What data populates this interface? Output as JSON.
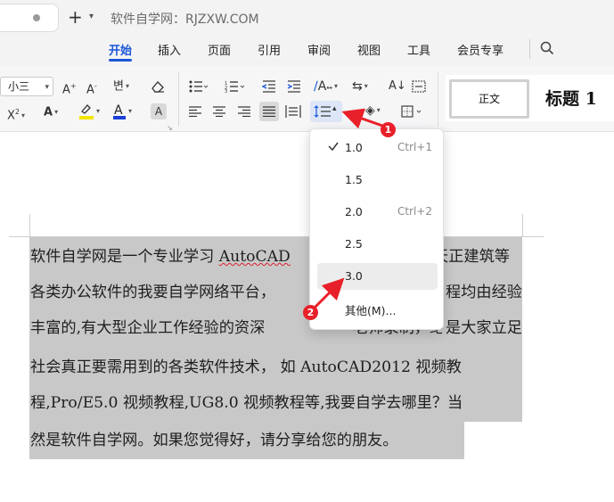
{
  "window": {
    "title": "软件自学网：RJZXW.COM"
  },
  "menu": {
    "items": [
      {
        "label": "开始",
        "active": true
      },
      {
        "label": "插入"
      },
      {
        "label": "页面"
      },
      {
        "label": "引用"
      },
      {
        "label": "审阅"
      },
      {
        "label": "视图"
      },
      {
        "label": "工具"
      },
      {
        "label": "会员专享"
      }
    ]
  },
  "ribbon": {
    "font_size": "小三",
    "styles": {
      "body_label": "正文",
      "heading_label": "标题 1"
    },
    "colors": {
      "highlight": "#f2e600",
      "font_color": "#1a3fd6",
      "accent": "#1a56d6"
    }
  },
  "line_spacing_menu": {
    "options": [
      {
        "label": "1.0",
        "shortcut": "Ctrl+1",
        "checked": true
      },
      {
        "label": "1.5",
        "shortcut": ""
      },
      {
        "label": "2.0",
        "shortcut": "Ctrl+2"
      },
      {
        "label": "2.5",
        "shortcut": ""
      },
      {
        "label": "3.0",
        "shortcut": "",
        "hover": true
      },
      {
        "label": "其他(M)...",
        "shortcut": ""
      }
    ]
  },
  "document": {
    "lines": [
      [
        "软件自学网是一个专业学习 ",
        "AutoCAD",
        "",
        "天正建筑等"
      ],
      [
        "各类办公软件的我要自学网络平台，",
        "",
        "",
        "程均由经验"
      ],
      [
        "丰富的,有大型企业工作经验的资深",
        "",
        "",
        "是大家立足"
      ],
      [
        "社会真正要需用到的各类软件技术， 如 AutoCAD2012 视频教"
      ],
      [
        "程,Pro/E5.0 视频教程,UG8.0 视频教程等,我要自学去哪里？当"
      ],
      [
        "然是软件自学网。如果您觉得好，请分享给您的朋友。"
      ]
    ],
    "behind_menu": [
      "老师录制，绝对"
    ]
  },
  "annotations": {
    "badge1": "1",
    "badge2": "2",
    "color": "#e8202a"
  }
}
